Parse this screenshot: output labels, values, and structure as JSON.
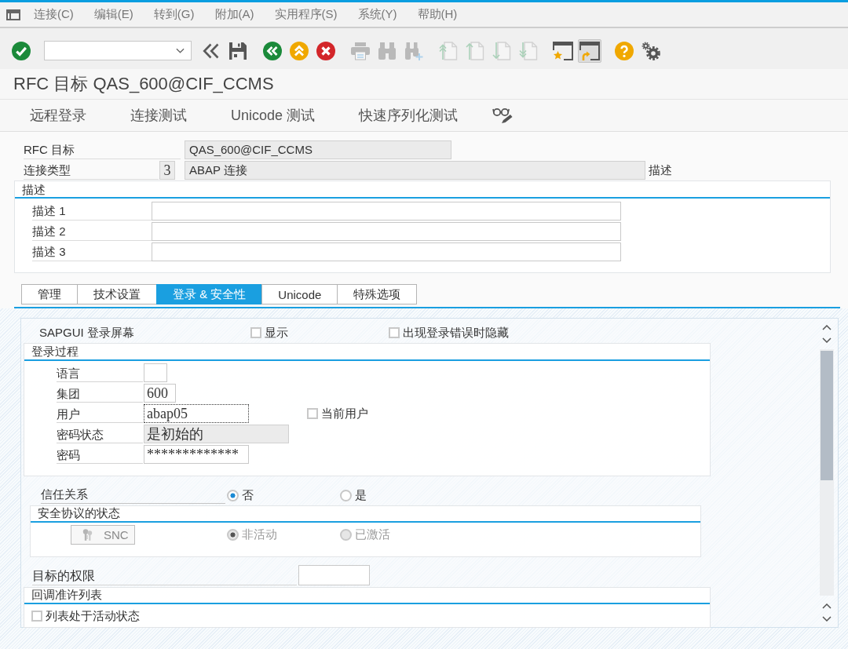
{
  "menu_bar": {
    "items": [
      "连接(C)",
      "编辑(E)",
      "转到(G)",
      "附加(A)",
      "实用程序(S)",
      "系统(Y)",
      "帮助(H)"
    ]
  },
  "toolbar": {
    "groups": [
      {
        "buttons": [
          {
            "kind": "enter",
            "disabled": false,
            "pressed": false
          }
        ]
      },
      {
        "buttons": [
          {
            "kind": "back-fast",
            "disabled": false,
            "pressed": false
          },
          {
            "kind": "save",
            "disabled": false,
            "pressed": false
          }
        ]
      },
      {
        "buttons": [
          {
            "kind": "back",
            "disabled": false,
            "pressed": false
          },
          {
            "kind": "exit",
            "disabled": false,
            "pressed": false
          },
          {
            "kind": "cancel",
            "disabled": false,
            "pressed": false
          }
        ]
      },
      {
        "buttons": [
          {
            "kind": "print",
            "disabled": true,
            "pressed": false
          },
          {
            "kind": "find",
            "disabled": true,
            "pressed": false
          },
          {
            "kind": "find-next",
            "disabled": true,
            "pressed": false
          }
        ]
      },
      {
        "buttons": [
          {
            "kind": "first-page",
            "disabled": true,
            "pressed": false
          },
          {
            "kind": "previous-page",
            "disabled": true,
            "pressed": false
          },
          {
            "kind": "next-page",
            "disabled": true,
            "pressed": false
          },
          {
            "kind": "last-page",
            "disabled": true,
            "pressed": false
          }
        ]
      },
      {
        "buttons": [
          {
            "kind": "new-session",
            "disabled": false,
            "pressed": false
          },
          {
            "kind": "shortcut",
            "disabled": false,
            "pressed": true
          }
        ]
      },
      {
        "buttons": [
          {
            "kind": "help",
            "disabled": false,
            "pressed": false
          },
          {
            "kind": "settings",
            "disabled": false,
            "pressed": false
          }
        ]
      }
    ]
  },
  "title": "RFC 目标 QAS_600@CIF_CCMS",
  "application_toolbar": {
    "buttons": [
      "远程登录",
      "连接测试",
      "Unicode 测试",
      "快速序列化测试"
    ]
  },
  "header": {
    "rfc_destination": {
      "label": "RFC 目标",
      "value": "QAS_600@CIF_CCMS"
    },
    "connection_type": {
      "label": "连接类型",
      "code": "3",
      "value": "ABAP 连接",
      "description_label": "描述"
    }
  },
  "description": {
    "title": "描述",
    "fields": [
      {
        "label": "描述 1"
      },
      {
        "label": "描述 2"
      },
      {
        "label": "描述 3"
      }
    ]
  },
  "tabs": [
    {
      "label": "管理",
      "selected": false
    },
    {
      "label": "技术设置",
      "selected": false
    },
    {
      "label": "登录 & 安全性",
      "selected": true
    },
    {
      "label": "Unicode",
      "selected": false
    },
    {
      "label": "特殊选项",
      "selected": false
    }
  ],
  "logon_security": {
    "sapgui_logon_screen": {
      "label": "SAPGUI 登录屏幕",
      "options": [
        {
          "label": "显示",
          "checked": false
        },
        {
          "label": "出现登录错误时隐藏",
          "checked": false
        }
      ]
    },
    "logon_procedure": {
      "title": "登录过程",
      "fields": [
        {
          "label": "语言",
          "readonly": false,
          "focused": false
        },
        {
          "label": "集团",
          "value": "600",
          "readonly": false,
          "focused": false
        },
        {
          "label": "用户",
          "value": "abap05",
          "readonly": false,
          "focused": true,
          "option": {
            "label": "当前用户",
            "checked": false
          }
        },
        {
          "label": "密码状态",
          "value": "是初始的",
          "readonly": true,
          "focused": false
        },
        {
          "label": "密码",
          "value": "*************",
          "readonly": false,
          "focused": false
        }
      ]
    },
    "trust_relationship": {
      "label": "信任关系",
      "options": [
        {
          "label": "否",
          "selected": true
        },
        {
          "label": "是",
          "selected": false
        }
      ]
    },
    "secure_protocol_status": {
      "title": "安全协议的状态",
      "snc_button": {
        "label": "SNC",
        "disabled": true
      },
      "options": [
        {
          "label": "非活动",
          "selected": true,
          "disabled": true
        },
        {
          "label": "已激活",
          "selected": false,
          "disabled": true
        }
      ]
    },
    "destination_authorization": {
      "label": "目标的权限"
    },
    "callback_allowlist": {
      "title": "回调准许列表",
      "active": {
        "label": "列表处于活动状态",
        "checked": false
      }
    }
  }
}
